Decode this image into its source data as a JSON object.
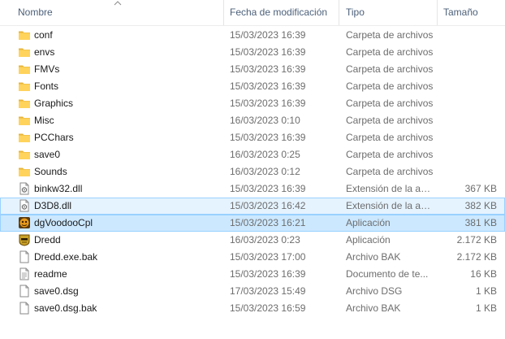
{
  "columns": {
    "name": "Nombre",
    "date": "Fecha de modificación",
    "type": "Tipo",
    "size": "Tamaño"
  },
  "files": [
    {
      "name": "conf",
      "date": "15/03/2023 16:39",
      "type": "Carpeta de archivos",
      "size": "",
      "icon": "folder-icon",
      "state": ""
    },
    {
      "name": "envs",
      "date": "15/03/2023 16:39",
      "type": "Carpeta de archivos",
      "size": "",
      "icon": "folder-icon",
      "state": ""
    },
    {
      "name": "FMVs",
      "date": "15/03/2023 16:39",
      "type": "Carpeta de archivos",
      "size": "",
      "icon": "folder-icon",
      "state": ""
    },
    {
      "name": "Fonts",
      "date": "15/03/2023 16:39",
      "type": "Carpeta de archivos",
      "size": "",
      "icon": "folder-icon",
      "state": ""
    },
    {
      "name": "Graphics",
      "date": "15/03/2023 16:39",
      "type": "Carpeta de archivos",
      "size": "",
      "icon": "folder-icon",
      "state": ""
    },
    {
      "name": "Misc",
      "date": "16/03/2023 0:10",
      "type": "Carpeta de archivos",
      "size": "",
      "icon": "folder-icon",
      "state": ""
    },
    {
      "name": "PCChars",
      "date": "15/03/2023 16:39",
      "type": "Carpeta de archivos",
      "size": "",
      "icon": "folder-icon",
      "state": ""
    },
    {
      "name": "save0",
      "date": "16/03/2023 0:25",
      "type": "Carpeta de archivos",
      "size": "",
      "icon": "folder-icon",
      "state": ""
    },
    {
      "name": "Sounds",
      "date": "16/03/2023 0:12",
      "type": "Carpeta de archivos",
      "size": "",
      "icon": "folder-icon",
      "state": ""
    },
    {
      "name": "binkw32.dll",
      "date": "15/03/2023 16:39",
      "type": "Extensión de la ap...",
      "size": "367 KB",
      "icon": "dll-file-icon",
      "state": ""
    },
    {
      "name": "D3D8.dll",
      "date": "15/03/2023 16:42",
      "type": "Extensión de la ap...",
      "size": "382 KB",
      "icon": "dll-file-icon",
      "state": "sel-light"
    },
    {
      "name": "dgVoodooCpl",
      "date": "15/03/2023 16:21",
      "type": "Aplicación",
      "size": "381 KB",
      "icon": "dgvoodoo-app-icon",
      "state": "sel"
    },
    {
      "name": "Dredd",
      "date": "16/03/2023 0:23",
      "type": "Aplicación",
      "size": "2.172 KB",
      "icon": "dredd-app-icon",
      "state": ""
    },
    {
      "name": "Dredd.exe.bak",
      "date": "15/03/2023 17:00",
      "type": "Archivo BAK",
      "size": "2.172 KB",
      "icon": "blank-file-icon",
      "state": ""
    },
    {
      "name": "readme",
      "date": "15/03/2023 16:39",
      "type": "Documento de te...",
      "size": "16 KB",
      "icon": "text-file-icon",
      "state": ""
    },
    {
      "name": "save0.dsg",
      "date": "17/03/2023 15:49",
      "type": "Archivo DSG",
      "size": "1 KB",
      "icon": "blank-file-icon",
      "state": ""
    },
    {
      "name": "save0.dsg.bak",
      "date": "15/03/2023 16:59",
      "type": "Archivo BAK",
      "size": "1 KB",
      "icon": "blank-file-icon",
      "state": ""
    }
  ]
}
